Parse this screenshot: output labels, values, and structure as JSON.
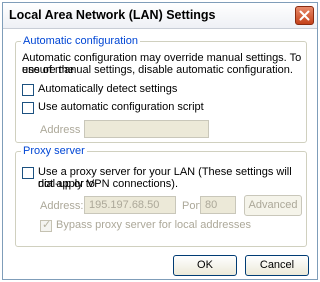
{
  "window": {
    "title": "Local Area Network (LAN) Settings",
    "close_icon": "close-icon"
  },
  "auto_config": {
    "title": "Automatic configuration",
    "description_line1": "Automatic configuration may override manual settings.  To ensure the",
    "description_line2": "use of manual settings, disable automatic configuration.",
    "detect_label": "Automatically detect settings",
    "script_label": "Use automatic configuration script",
    "address_label": "Address",
    "address_value": ""
  },
  "proxy": {
    "title": "Proxy server",
    "use_proxy_line1": "Use a proxy server for your LAN (These settings will not apply to",
    "use_proxy_line2": "dial-up or VPN connections).",
    "address_label": "Address:",
    "address_value": "195.197.68.50",
    "port_label": "Port:",
    "port_value": "80",
    "advanced_label": "Advanced",
    "bypass_label": "Bypass proxy server for local addresses"
  },
  "buttons": {
    "ok": "OK",
    "cancel": "Cancel"
  }
}
